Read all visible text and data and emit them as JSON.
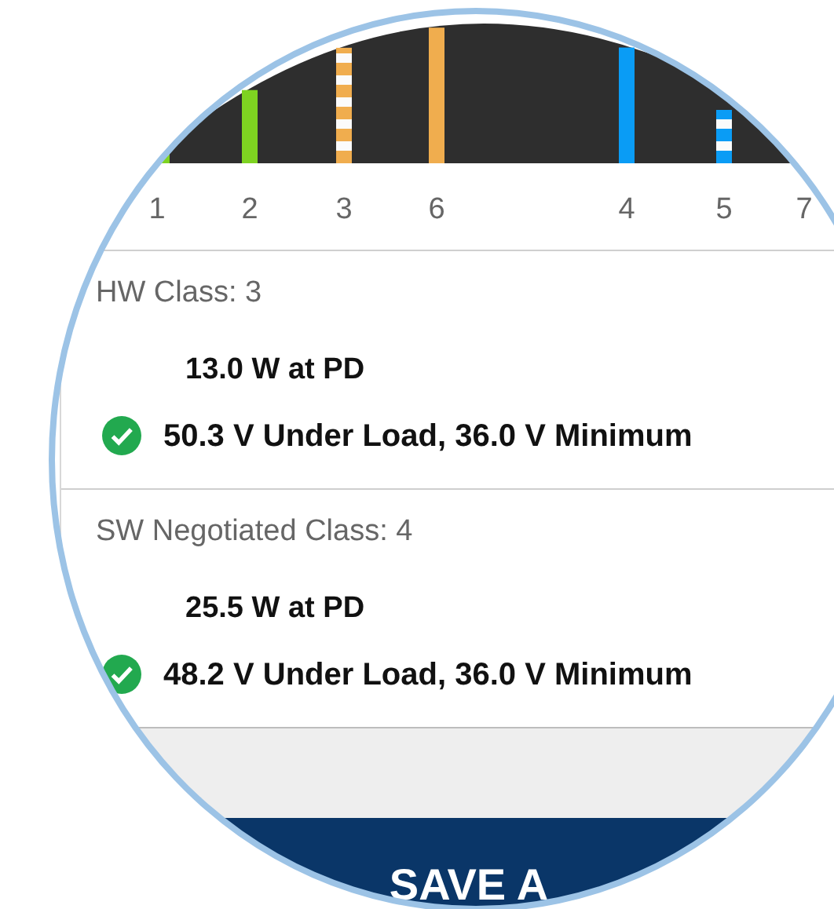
{
  "chart": {
    "markers": [
      {
        "label": "1",
        "color": "#7ed321",
        "dashed": false
      },
      {
        "label": "2",
        "color": "#7ed321",
        "dashed": false
      },
      {
        "label": "3",
        "color": "#f0ad4e",
        "dashed": true
      },
      {
        "label": "6",
        "color": "#f0ad4e",
        "dashed": false
      },
      {
        "label": "4",
        "color": "#0a9cf5",
        "dashed": false
      },
      {
        "label": "5",
        "color": "#0a9cf5",
        "dashed": true
      },
      {
        "label": "7"
      }
    ]
  },
  "sections": [
    {
      "heading": "HW Class: 3",
      "power": "13.0 W at PD",
      "voltage": "50.3 V Under Load, 36.0 V Minimum",
      "ok": true
    },
    {
      "heading": "SW Negotiated Class: 4",
      "power": "25.5 W at PD",
      "voltage": "48.2 V Under Load, 36.0 V Minimum",
      "ok": true
    }
  ],
  "button": {
    "label": "SAVE A"
  }
}
